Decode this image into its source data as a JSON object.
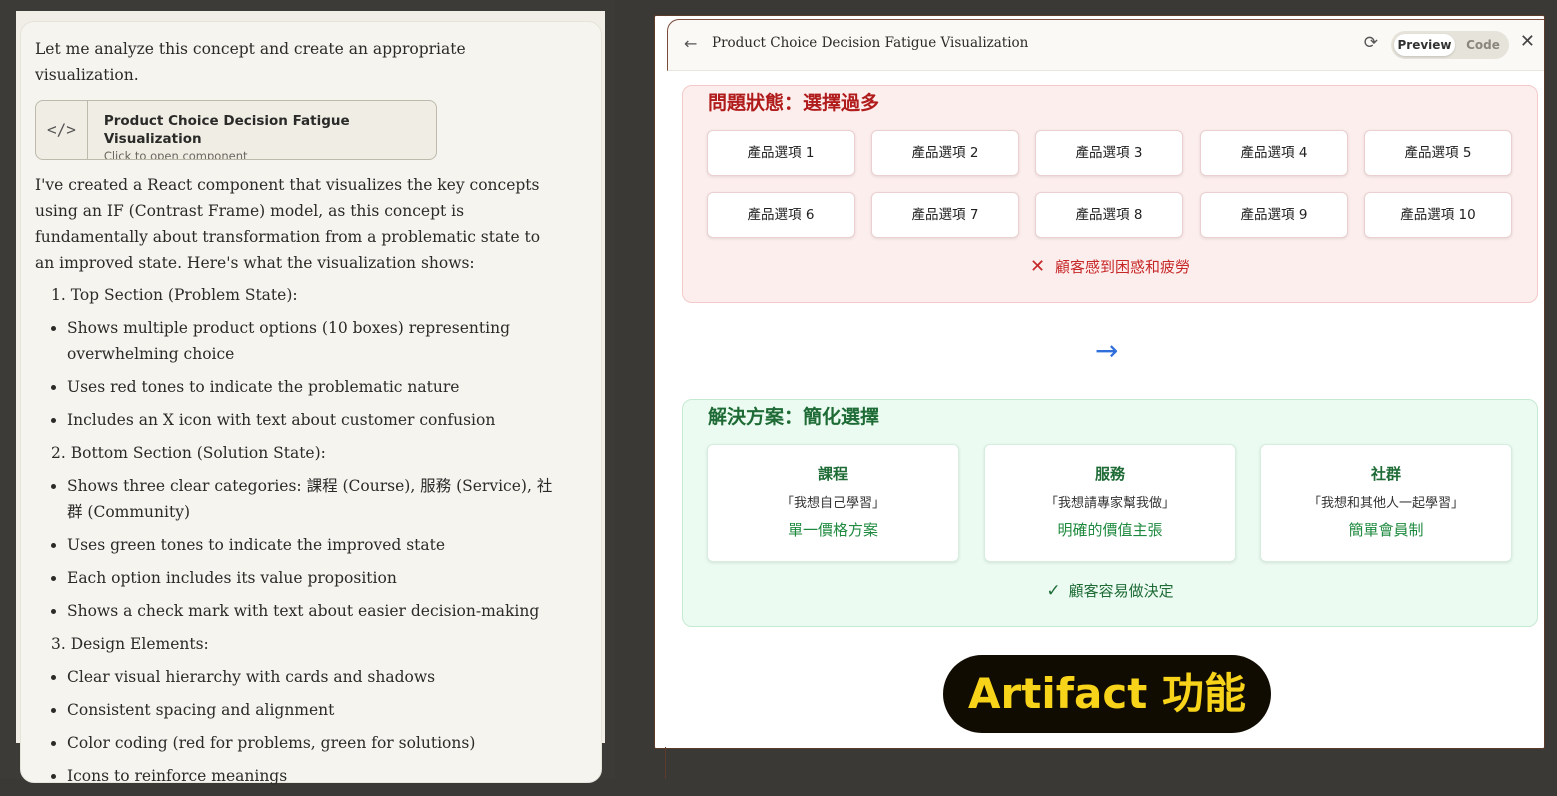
{
  "chat": {
    "intro": "Let me analyze this concept and create an appropriate visualization.",
    "artifact_card": {
      "code_glyph": "</>",
      "title": "Product Choice Decision Fatigue Visualization",
      "subtitle": "Click to open component"
    },
    "summary": "I've created a React component that visualizes the key concepts using an IF (Contrast Frame) model, as this concept is fundamentally about transformation from a problematic state to an improved state. Here's what the visualization shows:",
    "sections": [
      {
        "heading": "1. Top Section (Problem State):",
        "bullets": [
          "Shows multiple product options (10 boxes) representing overwhelming choice",
          "Uses red tones to indicate the problematic nature",
          "Includes an X icon with text about customer confusion"
        ]
      },
      {
        "heading": "2. Bottom Section (Solution State):",
        "bullets": [
          "Shows three clear categories: 課程 (Course), 服務 (Service), 社群 (Community)",
          "Uses green tones to indicate the improved state",
          "Each option includes its value proposition",
          "Shows a check mark with text about easier decision-making"
        ]
      },
      {
        "heading": "3. Design Elements:",
        "bullets": [
          "Clear visual hierarchy with cards and shadows",
          "Consistent spacing and alignment",
          "Color coding (red for problems, green for solutions)",
          "Icons to reinforce meanings"
        ]
      }
    ]
  },
  "artifact": {
    "title": "Product Choice Decision Fatigue Visualization",
    "tabs": {
      "preview": "Preview",
      "code": "Code"
    },
    "problem": {
      "heading": "問題狀態：選擇過多",
      "options": [
        "產品選項 1",
        "產品選項 2",
        "產品選項 3",
        "產品選項 4",
        "產品選項 5",
        "產品選項 6",
        "產品選項 7",
        "產品選項 8",
        "產品選項 9",
        "產品選項 10"
      ],
      "message": "顧客感到困惑和疲勞"
    },
    "solution": {
      "heading": "解決方案：簡化選擇",
      "categories": [
        {
          "name": "課程",
          "quote": "「我想自己學習」",
          "value": "單一價格方案"
        },
        {
          "name": "服務",
          "quote": "「我想請專家幫我做」",
          "value": "明確的價值主張"
        },
        {
          "name": "社群",
          "quote": "「我想和其他人一起學習」",
          "value": "簡單會員制"
        }
      ],
      "message": "顧客容易做決定"
    },
    "badge": "Artifact 功能"
  },
  "colors": {
    "problem_red": "#c62828",
    "solution_green": "#1e6b36",
    "arrow_blue": "#2f6fdb",
    "badge_yellow": "#f7d31a"
  }
}
